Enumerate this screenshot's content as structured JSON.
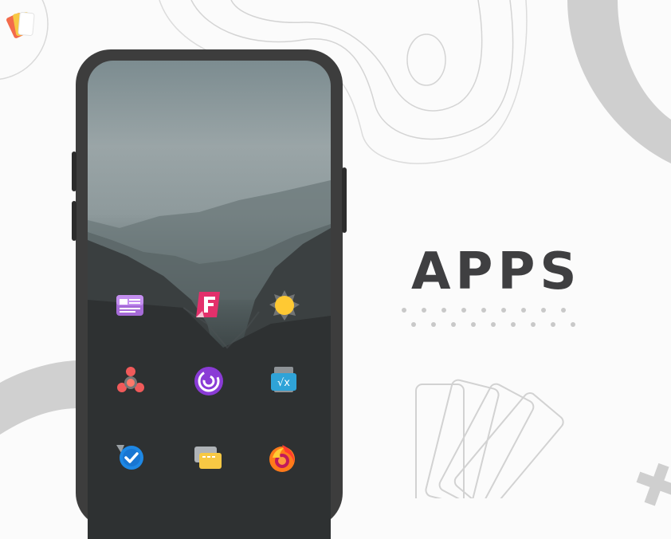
{
  "heading": {
    "text": "APPS"
  },
  "phone": {
    "apps": [
      {
        "name": "news-app"
      },
      {
        "name": "feedly-app"
      },
      {
        "name": "weather-app"
      },
      {
        "name": "molecule-app"
      },
      {
        "name": "swirl-app"
      },
      {
        "name": "math-app"
      },
      {
        "name": "tasks-app"
      },
      {
        "name": "files-app"
      },
      {
        "name": "firefox-app"
      }
    ]
  },
  "colors": {
    "accent_text": "#3f3f41",
    "phone_frame": "#3d3d3d",
    "dot_gray": "#c9c9c9",
    "line_gray": "#d6d6d6"
  }
}
